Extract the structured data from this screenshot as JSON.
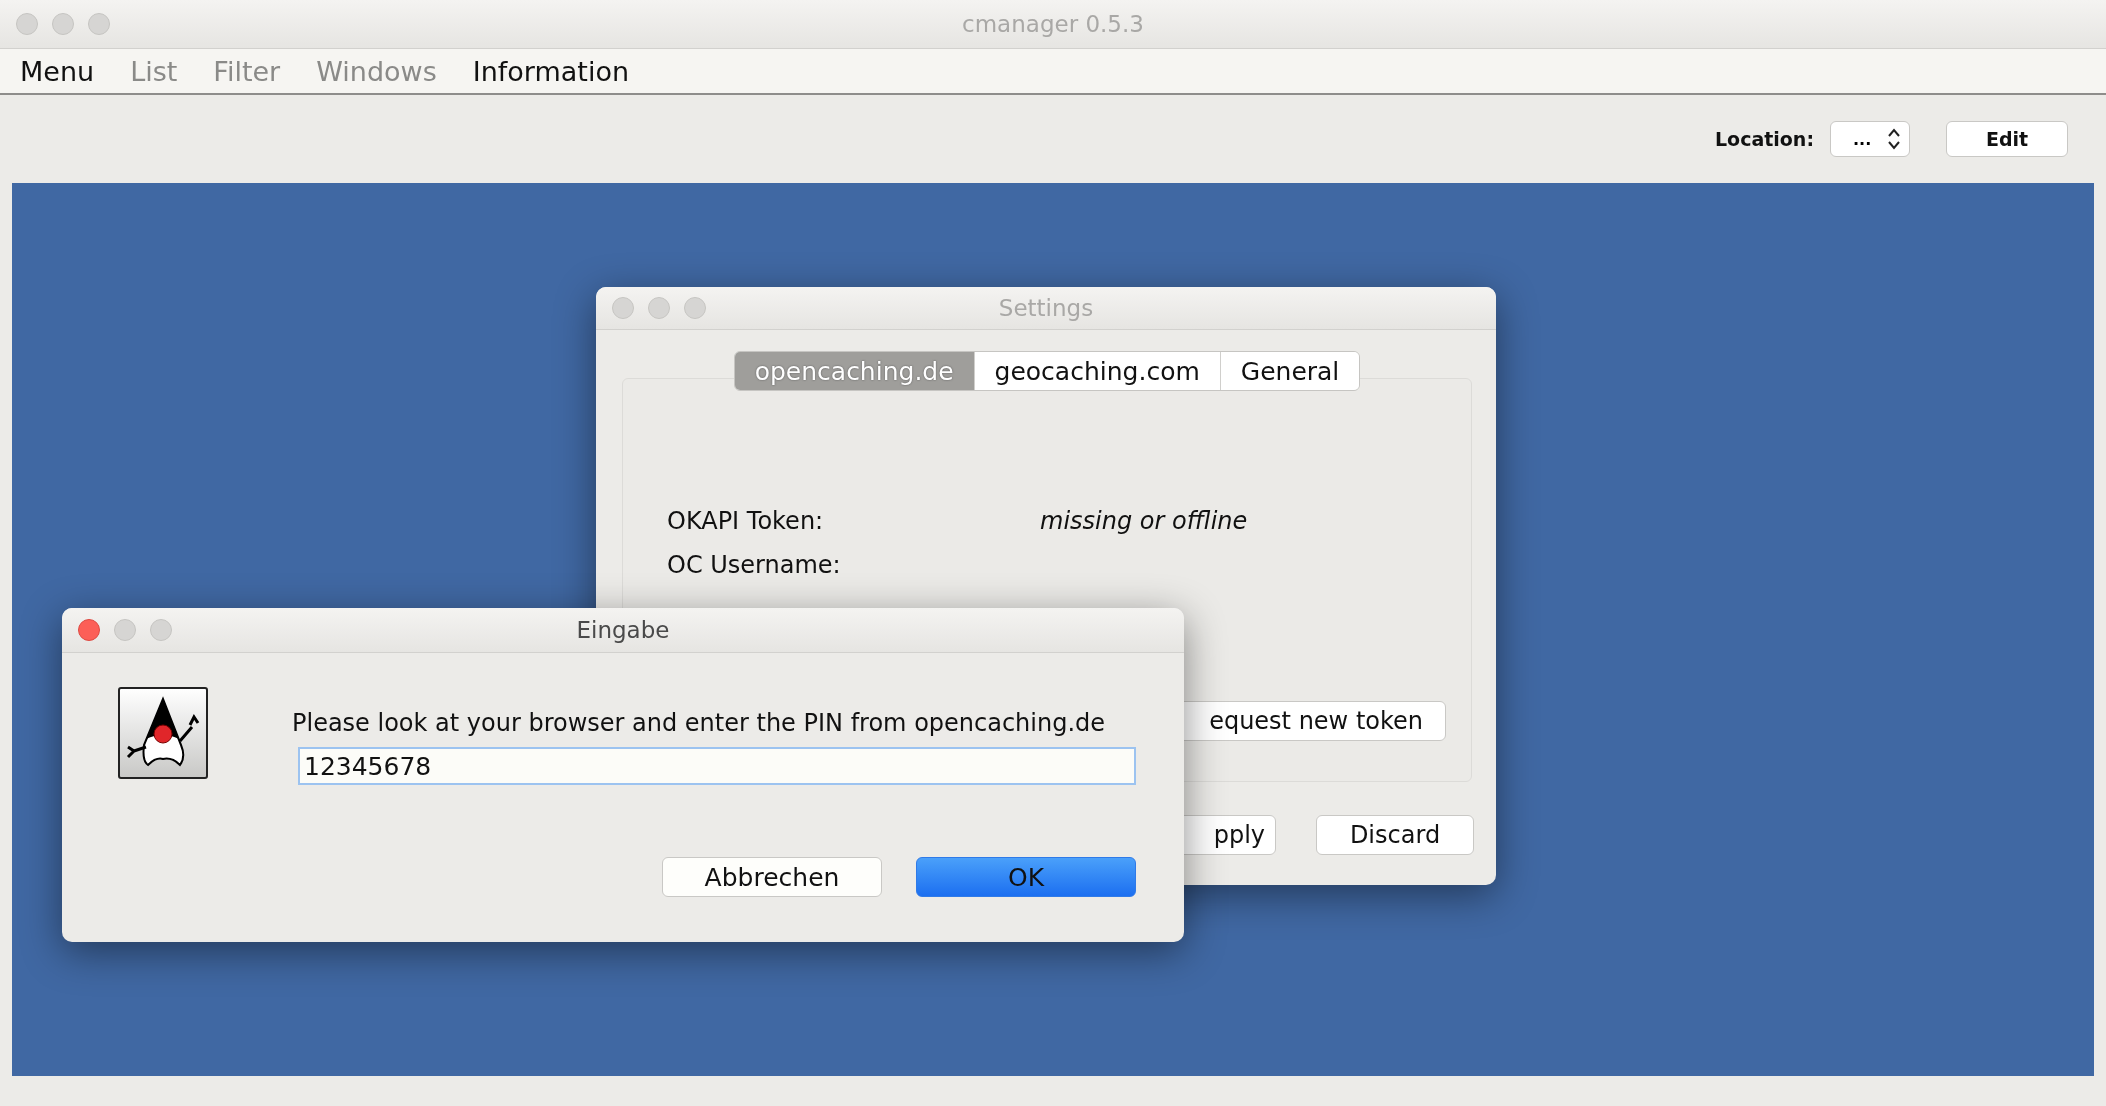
{
  "window": {
    "title": "cmanager 0.5.3",
    "active": false
  },
  "menu": [
    {
      "label": "Menu",
      "disabled": false
    },
    {
      "label": "List",
      "disabled": true
    },
    {
      "label": "Filter",
      "disabled": true
    },
    {
      "label": "Windows",
      "disabled": true
    },
    {
      "label": "Information",
      "disabled": false
    }
  ],
  "toolbar": {
    "location_label": "Location:",
    "location_value": "...",
    "edit_button": "Edit"
  },
  "settings": {
    "title": "Settings",
    "active": false,
    "tabs": [
      {
        "label": "opencaching.de",
        "selected": true
      },
      {
        "label": "geocaching.com",
        "selected": false
      },
      {
        "label": "General",
        "selected": false
      }
    ],
    "fields": [
      {
        "label": "OKAPI Token:",
        "value": "missing or offline"
      },
      {
        "label": "OC Username:"
      }
    ],
    "request_button": "equest new token",
    "apply_button": "pply",
    "discard_button": "Discard"
  },
  "input_dialog": {
    "title": "Eingabe",
    "active": true,
    "message": "Please look at your browser and enter the PIN from opencaching.de",
    "value": "12345678",
    "buttons": [
      {
        "label": "Abbrechen",
        "kind": "secondary"
      },
      {
        "label": "OK",
        "kind": "primary"
      }
    ]
  }
}
